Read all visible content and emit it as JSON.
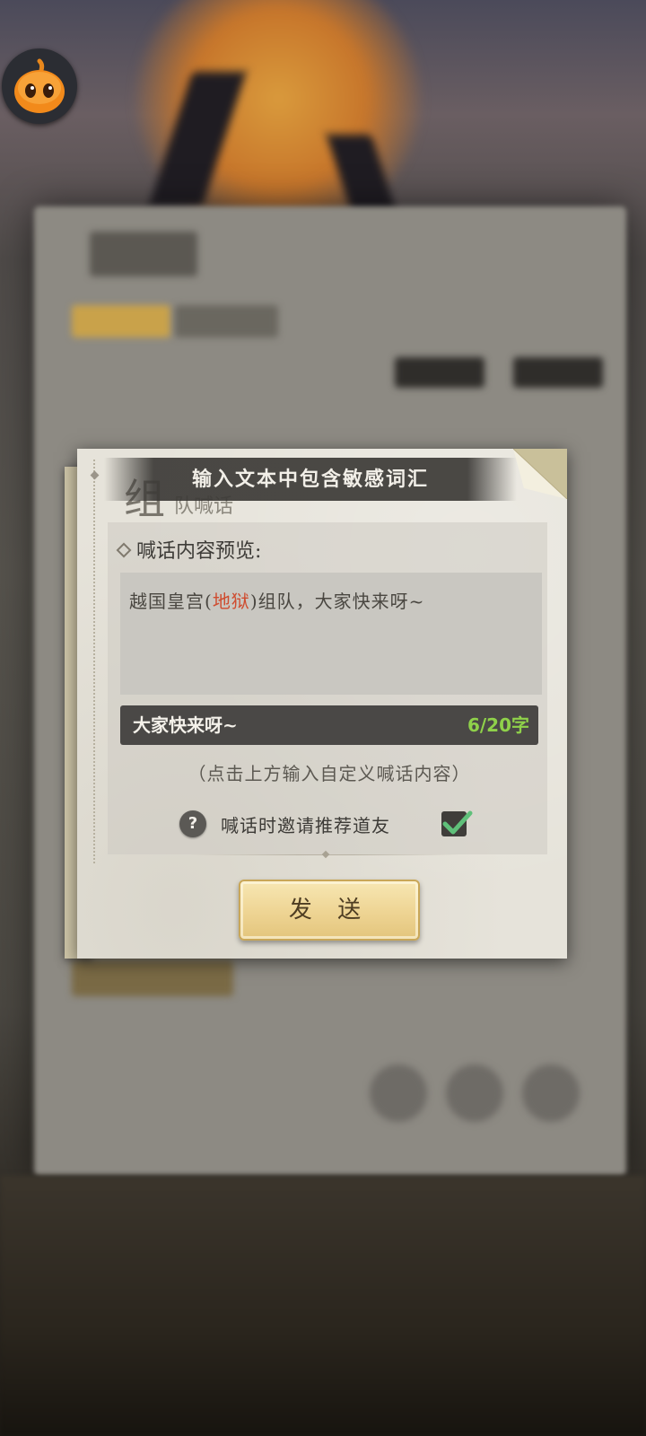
{
  "toast": {
    "message": "输入文本中包含敏感词汇"
  },
  "dialog": {
    "title_big": "组",
    "title_small": "队喊话",
    "preview_label": "喊话内容预览:",
    "preview": {
      "prefix": "越国皇宫(",
      "sensitive_word": "地狱",
      "suffix": ")组队，大家快来呀~"
    },
    "input": {
      "value": "大家快来呀~",
      "count": "6/20字"
    },
    "hint": "（点击上方输入自定义喊话内容）",
    "invite": {
      "help_icon": "?",
      "label": "喊话时邀请推荐道友",
      "checked": true
    },
    "send_button": "发 送"
  },
  "colors": {
    "sensitive_word": "#cf4b2e",
    "count": "#8fd14a",
    "button_gold": "#eed493"
  },
  "icons": {
    "mascot": "orange-pumpkin-mascot-icon",
    "help": "question-mark-icon",
    "check": "checkmark-icon"
  }
}
